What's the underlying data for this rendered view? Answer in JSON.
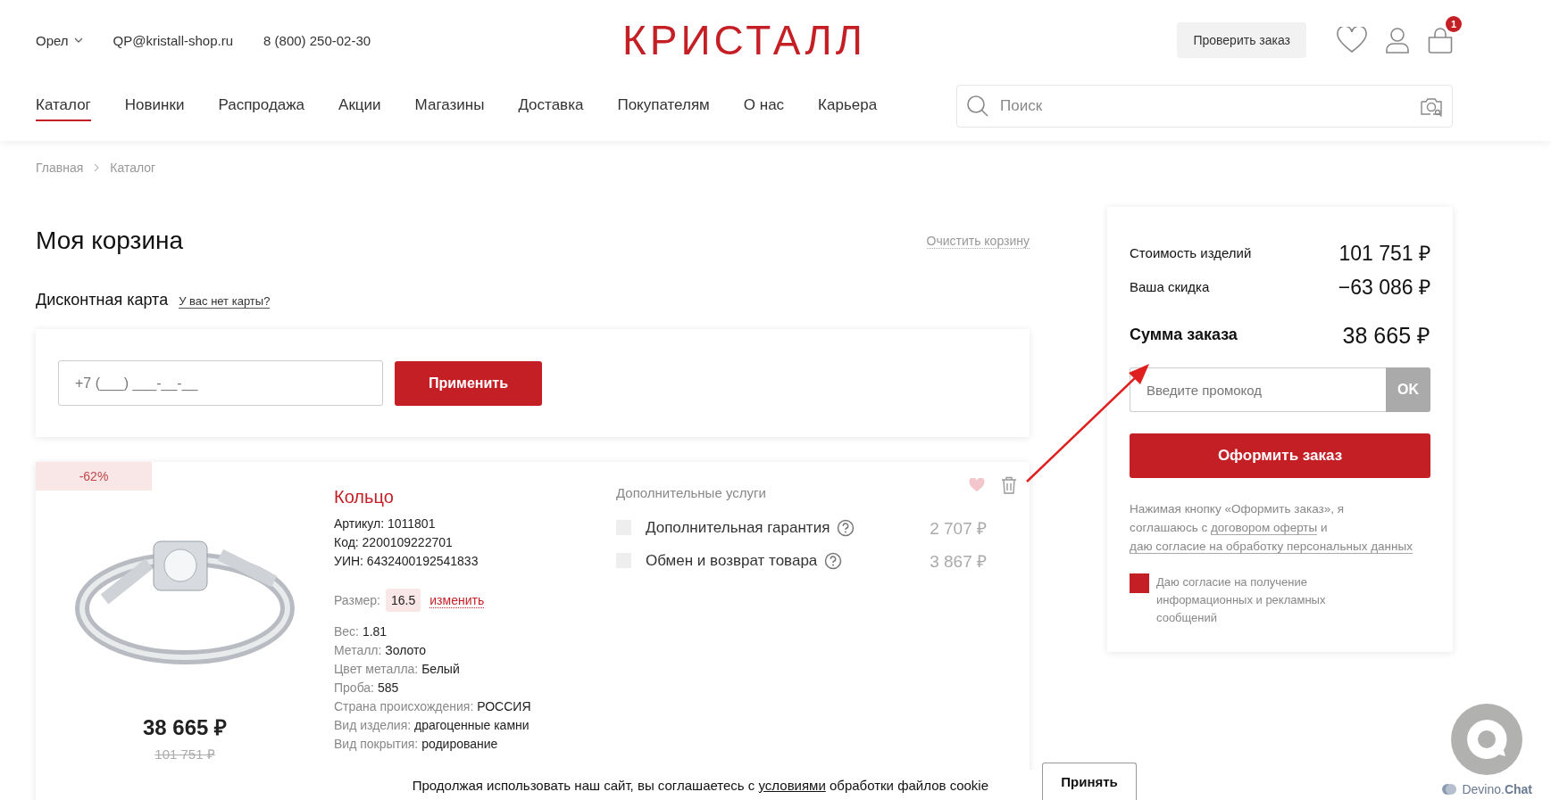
{
  "header": {
    "city": "Орел",
    "email": "QP@kristall-shop.ru",
    "phone": "8 (800) 250-02-30",
    "logo": "КРИСТАЛЛ",
    "check_order_button": "Проверить заказ",
    "cart_count": "1"
  },
  "nav": [
    {
      "label": "Каталог",
      "selected": true
    },
    {
      "label": "Новинки",
      "selected": false
    },
    {
      "label": "Распродажа",
      "selected": false
    },
    {
      "label": "Акции",
      "selected": false
    },
    {
      "label": "Магазины",
      "selected": false
    },
    {
      "label": "Доставка",
      "selected": false
    },
    {
      "label": "Покупателям",
      "selected": false
    },
    {
      "label": "О нас",
      "selected": false
    },
    {
      "label": "Карьера",
      "selected": false
    }
  ],
  "search": {
    "placeholder": "Поиск"
  },
  "breadcrumbs": [
    "Главная",
    "Каталог"
  ],
  "title": "Моя корзина",
  "clear_cart": "Очистить корзину",
  "discount_card": {
    "label": "Дисконтная карта",
    "link": "У вас нет карты?",
    "placeholder": "+7 (___) ___-__-__",
    "apply_button": "Применить"
  },
  "product": {
    "discount_badge": "-62%",
    "name": "Кольцо",
    "codes": [
      "Артикул: 1011801",
      "Код: 2200109222701",
      "УИН: 6432400192541833"
    ],
    "size_label": "Размер:",
    "size_value": "16.5",
    "size_change": "изменить",
    "specs": [
      {
        "label": "Вес:",
        "value": "1.81"
      },
      {
        "label": "Металл:",
        "value": "Золото"
      },
      {
        "label": "Цвет металла:",
        "value": "Белый"
      },
      {
        "label": "Проба:",
        "value": "585"
      },
      {
        "label": "Страна происхождения:",
        "value": "РОССИЯ"
      },
      {
        "label": "Вид изделия:",
        "value": "драгоценные камни"
      },
      {
        "label": "Вид покрытия:",
        "value": "родирование"
      }
    ],
    "price": "38 665 ₽",
    "old_price": "101 751 ₽",
    "services_title": "Дополнительные услуги",
    "services": [
      {
        "label": "Дополнительная гарантия",
        "price": "2 707 ₽",
        "checked": false
      },
      {
        "label": "Обмен и возврат товара",
        "price": "3 867 ₽",
        "checked": false
      }
    ]
  },
  "summary": {
    "rows": [
      {
        "kind": "normal",
        "label": "Стоимость изделий",
        "value": "101 751 ₽"
      },
      {
        "kind": "normal",
        "label": "Ваша скидка",
        "value": "−63 086 ₽"
      },
      {
        "kind": "total",
        "label": "Сумма заказа",
        "value": "38 665 ₽"
      }
    ],
    "promo_placeholder": "Введите промокод",
    "ok_button": "OK",
    "checkout_button": "Оформить заказ",
    "agreement": {
      "text_before": "Нажимая кнопку «Оформить заказ», я соглашаюсь с ",
      "link_offer": "договором оферты",
      "text_middle": " и ",
      "link_consent": "даю согласие на обработку персональных данных"
    },
    "consent": {
      "label": "Даю согласие на получение информационных и рекламных сообщений",
      "checked": true
    }
  },
  "cookie": {
    "text_before": "Продолжая использовать наш сайт, вы соглашаетесь с ",
    "link": "условиями",
    "text_after": " обработки файлов cookie",
    "accept_button": "Принять"
  },
  "chat": {
    "brand": "Devino.**Chat**"
  }
}
